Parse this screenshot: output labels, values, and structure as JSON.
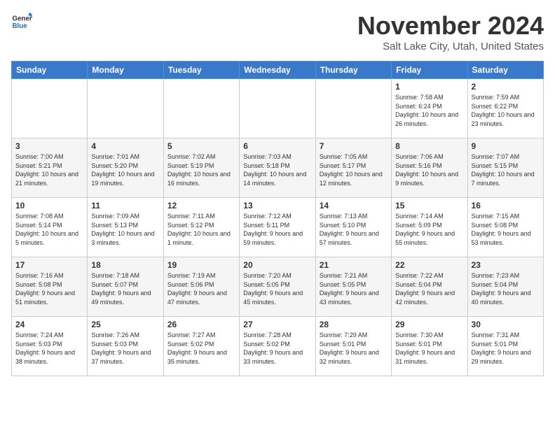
{
  "header": {
    "logo_general": "General",
    "logo_blue": "Blue",
    "month_title": "November 2024",
    "location": "Salt Lake City, Utah, United States"
  },
  "days_of_week": [
    "Sunday",
    "Monday",
    "Tuesday",
    "Wednesday",
    "Thursday",
    "Friday",
    "Saturday"
  ],
  "weeks": [
    [
      {
        "day": "",
        "info": ""
      },
      {
        "day": "",
        "info": ""
      },
      {
        "day": "",
        "info": ""
      },
      {
        "day": "",
        "info": ""
      },
      {
        "day": "",
        "info": ""
      },
      {
        "day": "1",
        "info": "Sunrise: 7:58 AM\nSunset: 6:24 PM\nDaylight: 10 hours and 26 minutes."
      },
      {
        "day": "2",
        "info": "Sunrise: 7:59 AM\nSunset: 6:22 PM\nDaylight: 10 hours and 23 minutes."
      }
    ],
    [
      {
        "day": "3",
        "info": "Sunrise: 7:00 AM\nSunset: 5:21 PM\nDaylight: 10 hours and 21 minutes."
      },
      {
        "day": "4",
        "info": "Sunrise: 7:01 AM\nSunset: 5:20 PM\nDaylight: 10 hours and 19 minutes."
      },
      {
        "day": "5",
        "info": "Sunrise: 7:02 AM\nSunset: 5:19 PM\nDaylight: 10 hours and 16 minutes."
      },
      {
        "day": "6",
        "info": "Sunrise: 7:03 AM\nSunset: 5:18 PM\nDaylight: 10 hours and 14 minutes."
      },
      {
        "day": "7",
        "info": "Sunrise: 7:05 AM\nSunset: 5:17 PM\nDaylight: 10 hours and 12 minutes."
      },
      {
        "day": "8",
        "info": "Sunrise: 7:06 AM\nSunset: 5:16 PM\nDaylight: 10 hours and 9 minutes."
      },
      {
        "day": "9",
        "info": "Sunrise: 7:07 AM\nSunset: 5:15 PM\nDaylight: 10 hours and 7 minutes."
      }
    ],
    [
      {
        "day": "10",
        "info": "Sunrise: 7:08 AM\nSunset: 5:14 PM\nDaylight: 10 hours and 5 minutes."
      },
      {
        "day": "11",
        "info": "Sunrise: 7:09 AM\nSunset: 5:13 PM\nDaylight: 10 hours and 3 minutes."
      },
      {
        "day": "12",
        "info": "Sunrise: 7:11 AM\nSunset: 5:12 PM\nDaylight: 10 hours and 1 minute."
      },
      {
        "day": "13",
        "info": "Sunrise: 7:12 AM\nSunset: 5:11 PM\nDaylight: 9 hours and 59 minutes."
      },
      {
        "day": "14",
        "info": "Sunrise: 7:13 AM\nSunset: 5:10 PM\nDaylight: 9 hours and 57 minutes."
      },
      {
        "day": "15",
        "info": "Sunrise: 7:14 AM\nSunset: 5:09 PM\nDaylight: 9 hours and 55 minutes."
      },
      {
        "day": "16",
        "info": "Sunrise: 7:15 AM\nSunset: 5:08 PM\nDaylight: 9 hours and 53 minutes."
      }
    ],
    [
      {
        "day": "17",
        "info": "Sunrise: 7:16 AM\nSunset: 5:08 PM\nDaylight: 9 hours and 51 minutes."
      },
      {
        "day": "18",
        "info": "Sunrise: 7:18 AM\nSunset: 5:07 PM\nDaylight: 9 hours and 49 minutes."
      },
      {
        "day": "19",
        "info": "Sunrise: 7:19 AM\nSunset: 5:06 PM\nDaylight: 9 hours and 47 minutes."
      },
      {
        "day": "20",
        "info": "Sunrise: 7:20 AM\nSunset: 5:05 PM\nDaylight: 9 hours and 45 minutes."
      },
      {
        "day": "21",
        "info": "Sunrise: 7:21 AM\nSunset: 5:05 PM\nDaylight: 9 hours and 43 minutes."
      },
      {
        "day": "22",
        "info": "Sunrise: 7:22 AM\nSunset: 5:04 PM\nDaylight: 9 hours and 42 minutes."
      },
      {
        "day": "23",
        "info": "Sunrise: 7:23 AM\nSunset: 5:04 PM\nDaylight: 9 hours and 40 minutes."
      }
    ],
    [
      {
        "day": "24",
        "info": "Sunrise: 7:24 AM\nSunset: 5:03 PM\nDaylight: 9 hours and 38 minutes."
      },
      {
        "day": "25",
        "info": "Sunrise: 7:26 AM\nSunset: 5:03 PM\nDaylight: 9 hours and 37 minutes."
      },
      {
        "day": "26",
        "info": "Sunrise: 7:27 AM\nSunset: 5:02 PM\nDaylight: 9 hours and 35 minutes."
      },
      {
        "day": "27",
        "info": "Sunrise: 7:28 AM\nSunset: 5:02 PM\nDaylight: 9 hours and 33 minutes."
      },
      {
        "day": "28",
        "info": "Sunrise: 7:29 AM\nSunset: 5:01 PM\nDaylight: 9 hours and 32 minutes."
      },
      {
        "day": "29",
        "info": "Sunrise: 7:30 AM\nSunset: 5:01 PM\nDaylight: 9 hours and 31 minutes."
      },
      {
        "day": "30",
        "info": "Sunrise: 7:31 AM\nSunset: 5:01 PM\nDaylight: 9 hours and 29 minutes."
      }
    ]
  ]
}
